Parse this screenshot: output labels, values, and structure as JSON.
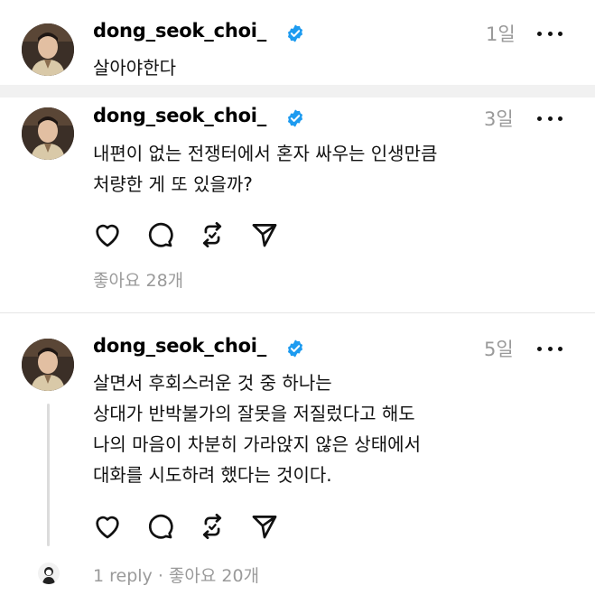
{
  "posts": [
    {
      "username": "dong_seok_choi_",
      "time": "1일",
      "lines": [
        "살아야한다"
      ]
    },
    {
      "username": "dong_seok_choi_",
      "time": "3일",
      "lines": [
        "내편이 없는 전쟁터에서 혼자 싸우는 인생만큼",
        "처량한 게 또 있을까?"
      ],
      "likes": "좋아요 28개"
    },
    {
      "username": "dong_seok_choi_",
      "time": "5일",
      "lines": [
        "살면서 후회스러운 것 중 하나는",
        "상대가 반박불가의 잘못을 저질렀다고 해도",
        "나의 마음이 차분히 가라앉지 않은 상태에서",
        "대화를 시도하려 했다는 것이다."
      ],
      "footer": "1 reply · 좋아요 20개"
    }
  ],
  "icons": {
    "verified": "verified-badge-icon",
    "more": "more-dots-icon",
    "like": "heart-icon",
    "comment": "comment-bubble-icon",
    "repost": "repost-icon",
    "share": "send-icon"
  },
  "colors": {
    "verified": "#1d9bf0",
    "muted": "#9a9a9a",
    "divider": "#e6e6e6"
  }
}
